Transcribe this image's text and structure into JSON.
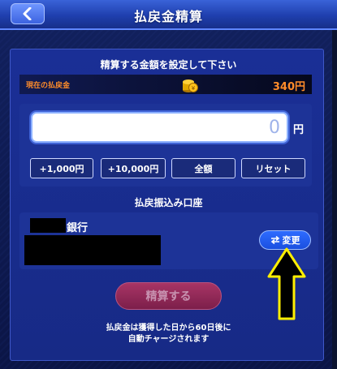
{
  "header": {
    "title": "払戻金精算"
  },
  "amount_section": {
    "title": "精算する金額を設定して下さい",
    "current_label": "現在の払戻金",
    "current_value": "340円",
    "input_value": "",
    "input_placeholder": "0",
    "unit": "円",
    "quick_buttons": [
      "+1,000円",
      "+10,000円",
      "全額",
      "リセット"
    ]
  },
  "bank_section": {
    "title": "払戻振込み口座",
    "bank_suffix": "銀行",
    "change_label": "変更"
  },
  "settle_button": "精算する",
  "note": {
    "line1": "払戻金は獲得した日から60日後に",
    "line2": "自動チャージされます"
  },
  "colors": {
    "accent_orange": "#ff8c2a",
    "arrow_yellow": "#ffef00",
    "settle_red": "#a82a50"
  }
}
